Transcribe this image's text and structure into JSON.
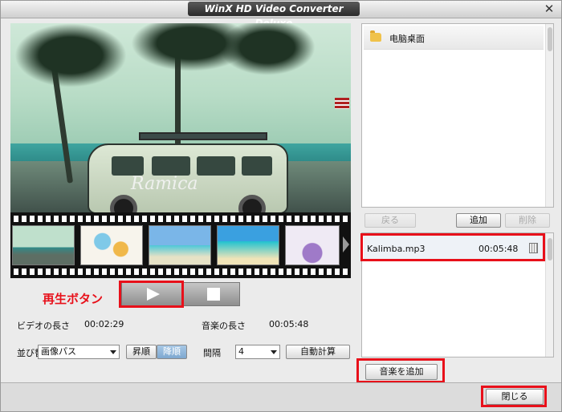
{
  "window": {
    "title": "WinX HD Video Converter Deluxe",
    "close_glyph": "✕"
  },
  "preview": {
    "watermark": "Ramica"
  },
  "annotation": {
    "play_label": "再生ボタン",
    "color": "#e8101a"
  },
  "info": {
    "video_length_label": "ビデオの長さ",
    "video_length_value": "00:02:29",
    "music_length_label": "音楽の長さ",
    "music_length_value": "00:05:48"
  },
  "sort": {
    "label": "並び替",
    "selected": "画像パス",
    "asc_label": "昇順",
    "desc_label": "降順"
  },
  "interval": {
    "label": "間隔",
    "selected": "4",
    "auto_calc_label": "自動計算"
  },
  "file_browser": {
    "items": [
      {
        "name": "电脑桌面",
        "icon": "folder-icon"
      }
    ]
  },
  "music_toolbar": {
    "back_label": "戻る",
    "add_label": "追加",
    "delete_label": "削除"
  },
  "music_list": {
    "items": [
      {
        "name": "Kalimba.mp3",
        "duration": "00:05:48"
      }
    ]
  },
  "add_music_label": "音楽を追加",
  "close_label": "閉じる"
}
